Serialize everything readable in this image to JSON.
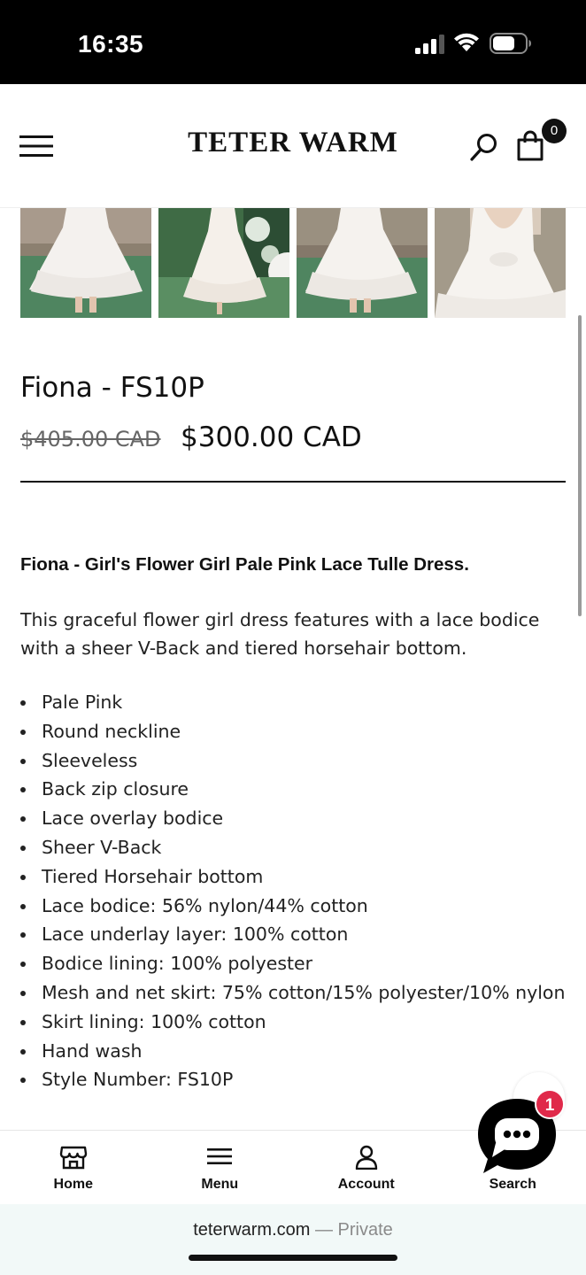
{
  "status_bar": {
    "time": "16:35"
  },
  "header": {
    "brand": "TETER WARM",
    "cart_count": "0"
  },
  "gallery": {
    "thumbnails": [
      "thumb-1",
      "thumb-2",
      "thumb-3",
      "thumb-4"
    ]
  },
  "product": {
    "title": "Fiona - FS10P",
    "price_old": "$405.00 CAD",
    "price_new": "$300.00 CAD",
    "description_heading": "Fiona - Girl's Flower Girl Pale Pink Lace Tulle Dress.",
    "description_body": "This graceful flower girl dress features with a lace bodice with a sheer V-Back and tiered horsehair bottom.",
    "features": [
      "Pale Pink",
      "Round neckline",
      "Sleeveless",
      "Back zip closure",
      "Lace overlay bodice",
      "Sheer V-Back",
      "Tiered Horsehair bottom",
      "Lace bodice: 56% nylon/44% cotton",
      "Lace underlay layer: 100% cotton",
      "Bodice lining: 100% polyester",
      "Mesh and net skirt: 75% cotton/15% polyester/10% nylon",
      "Skirt lining: 100% cotton",
      "Hand wash",
      "Style Number: FS10P"
    ]
  },
  "chat": {
    "badge": "1"
  },
  "bottom_nav": {
    "items": [
      {
        "label": "Home",
        "icon": "store-icon"
      },
      {
        "label": "Menu",
        "icon": "menu-icon"
      },
      {
        "label": "Account",
        "icon": "user-icon"
      },
      {
        "label": "Search",
        "icon": "search-icon"
      }
    ]
  },
  "browser": {
    "domain": "teterwarm.com",
    "suffix": " — Private"
  },
  "colors": {
    "chat_badge": "#e0294a",
    "grass": "#4e7f5a",
    "dress": "#f4f1ee"
  }
}
